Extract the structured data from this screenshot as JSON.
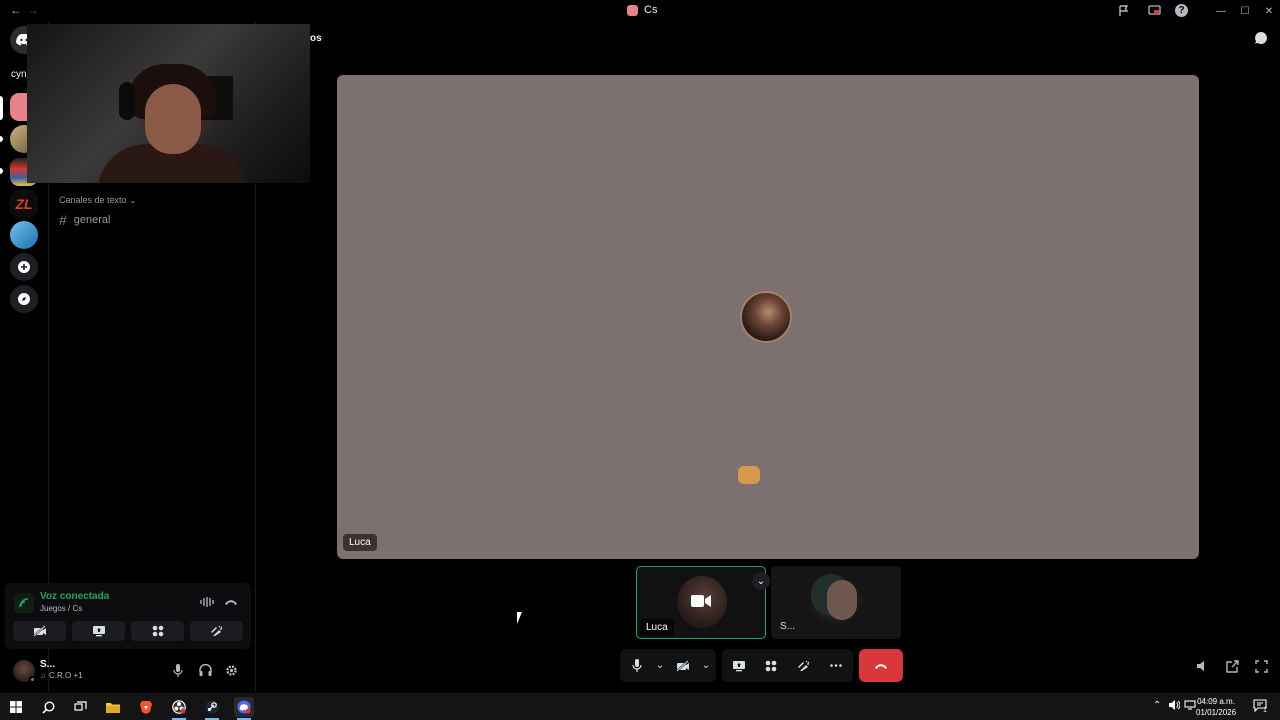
{
  "titlebar": {
    "title": "Cs",
    "back_icon": "←",
    "forward_icon": "→",
    "right_icons": [
      "inbox-icon",
      "screen-icon",
      "help-icon"
    ],
    "help": "?",
    "win_min": "—",
    "win_max": "☐",
    "win_close": "✕"
  },
  "rail": {
    "servers": [
      {
        "name": "discord-home",
        "glyph": "◉",
        "color": "#5865f2"
      },
      {
        "name": "server-pink",
        "glyph": "",
        "color": "#e8828a"
      },
      {
        "name": "server-art",
        "glyph": "",
        "color": "#8b7b5a"
      },
      {
        "name": "server-game",
        "glyph": "",
        "color": "#3a5fa6"
      },
      {
        "name": "server-zl",
        "glyph": "ZL",
        "color": "#d13b2d"
      },
      {
        "name": "server-sky",
        "glyph": "",
        "color": "#4aa3d6"
      },
      {
        "name": "add-server",
        "glyph": "+",
        "color": "#111"
      },
      {
        "name": "discover",
        "glyph": "⊘",
        "color": "#111"
      }
    ]
  },
  "sidebar": {
    "partial_server": "cyn",
    "partial_header": "os",
    "category": "Canales de texto",
    "channel": "general"
  },
  "voice": {
    "status": "Voz conectada",
    "channel_path": "Juegos / Cs"
  },
  "user": {
    "name": "S...",
    "activity": "C.R.O +1"
  },
  "stage": {
    "main_participant": "Luca"
  },
  "tiles": {
    "tile1_name": "Luca",
    "tile2_name": "S..."
  },
  "taskbar": {
    "time": "04:09 a.m.",
    "date": "01/01/2026",
    "notif_count": "1"
  },
  "colors": {
    "accent_green": "#23a55a",
    "hangup_red": "#da373c",
    "stage_bg": "#7c7071"
  }
}
